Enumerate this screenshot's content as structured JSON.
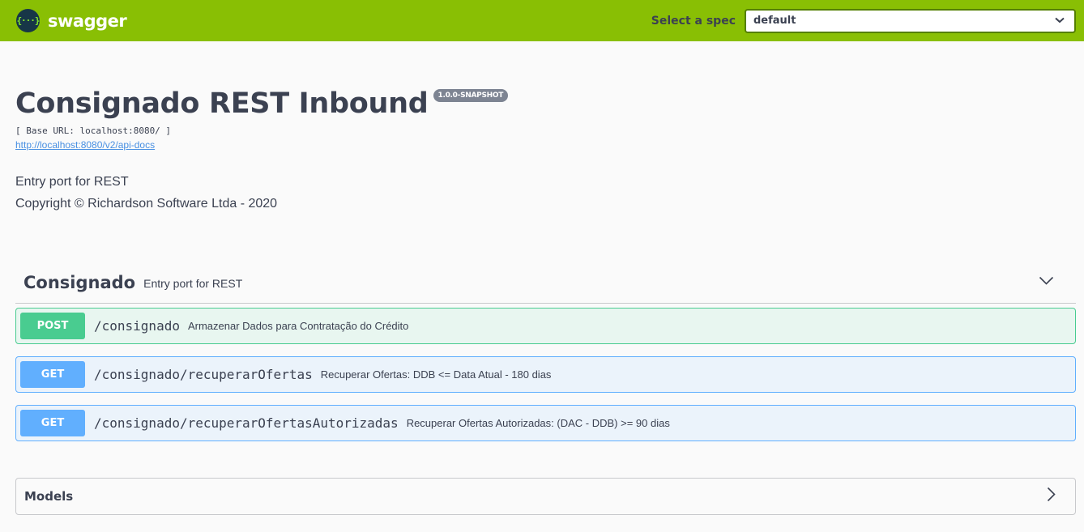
{
  "topbar": {
    "logo_glyph": "{···}",
    "logo_text": "swagger",
    "spec_label": "Select a spec",
    "spec_selected": "default"
  },
  "info": {
    "title": "Consignado REST Inbound",
    "version": "1.0.0-SNAPSHOT",
    "base_url": "[ Base URL: localhost:8080/ ]",
    "docs_link": "http://localhost:8080/v2/api-docs",
    "description_lines": [
      "Entry port for REST",
      "Copyright © Richardson Software Ltda - 2020"
    ]
  },
  "tag": {
    "name": "Consignado",
    "description": "Entry port for REST"
  },
  "operations": [
    {
      "method": "POST",
      "path": "/consignado",
      "summary": "Armazenar Dados para Contratação do Crédito",
      "color": "#49cc90"
    },
    {
      "method": "GET",
      "path": "/consignado/recuperarOfertas",
      "summary": "Recuperar Ofertas: DDB <= Data Atual - 180 dias",
      "color": "#61affe"
    },
    {
      "method": "GET",
      "path": "/consignado/recuperarOfertasAutorizadas",
      "summary": "Recuperar Ofertas Autorizadas: (DAC - DDB) >= 90 dias",
      "color": "#61affe"
    }
  ],
  "models": {
    "title": "Models"
  },
  "icons": {
    "spec_dropdown": "chevron-down-icon",
    "tag_toggle": "chevron-down-icon",
    "models_toggle": "chevron-right-icon"
  },
  "colors": {
    "topbar": "#89bf04",
    "post": "#49cc90",
    "get": "#61affe"
  }
}
